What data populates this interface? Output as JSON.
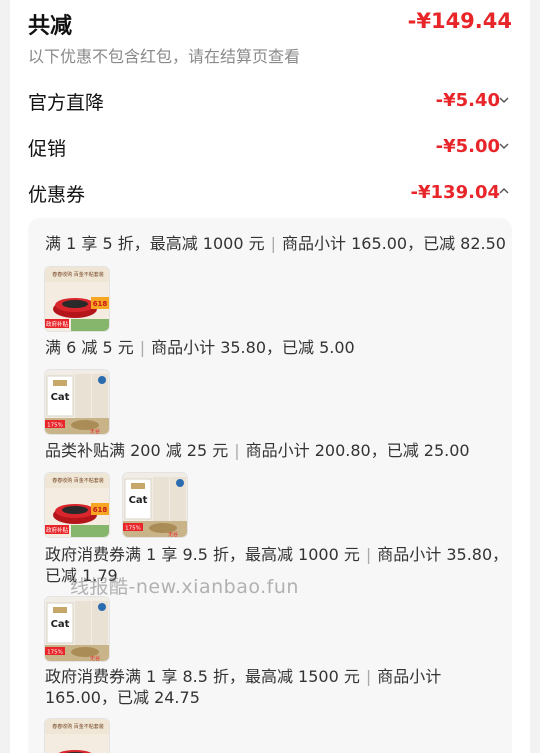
{
  "summary": {
    "total_label": "共减",
    "total_amount": "-¥149.44",
    "note": "以下优惠不包含红包，请在结算页查看"
  },
  "rows": [
    {
      "label": "官方直降",
      "amount": "-¥5.40",
      "chevron": "chevron-down-icon"
    },
    {
      "label": "促销",
      "amount": "-¥5.00",
      "chevron": "chevron-down-icon"
    },
    {
      "label": "优惠券",
      "amount": "-¥139.04",
      "chevron": "chevron-up-icon"
    }
  ],
  "coupons": [
    {
      "line": "满 1 享 5 折，最高减 1000 元",
      "detail": "商品小计 165.00，已减 82.50",
      "products": [
        "pot-set"
      ]
    },
    {
      "line": "满 6 减 5 元",
      "detail": "商品小计 35.80，已减 5.00",
      "products": [
        "cat-food"
      ]
    },
    {
      "line": "品类补贴满 200 减 25 元",
      "detail": "商品小计 200.80，已减 25.00",
      "products": [
        "pot-set",
        "cat-food"
      ]
    },
    {
      "line": "政府消费券满 1 享 9.5 折，最高减 1000 元",
      "detail": "商品小计 35.80，",
      "detail_cont": "已减 1.79",
      "products": [
        "cat-food"
      ]
    },
    {
      "line": "政府消费券满 1 享 8.5 折，最高减 1500 元",
      "detail": "商品小计",
      "detail_cont": "165.00，已减 24.75",
      "products": [
        "pot-set"
      ]
    }
  ],
  "product_text": {
    "pot_banner": "春春收购 百金不粘套装",
    "pot_badge": "政府补贴",
    "pot_tag": "618",
    "cat_brand": "Cat",
    "cat_percent": "175%",
    "cat_tag": "无谷"
  },
  "watermark": "线报酷-new.xianbao.fun",
  "colors": {
    "accent": "#e8262a",
    "text": "#111111",
    "muted": "#8a8a8a",
    "panel": "#f7f7f8"
  }
}
